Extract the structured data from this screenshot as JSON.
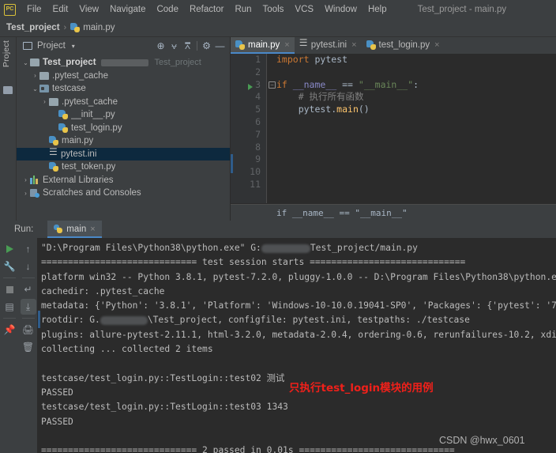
{
  "window": {
    "title": "Test_project - main.py",
    "logo_text": "PC",
    "logo_name": "pycharm-logo-icon"
  },
  "menubar": {
    "items": [
      {
        "label": "File"
      },
      {
        "label": "Edit"
      },
      {
        "label": "View"
      },
      {
        "label": "Navigate"
      },
      {
        "label": "Code"
      },
      {
        "label": "Refactor"
      },
      {
        "label": "Run"
      },
      {
        "label": "Tools"
      },
      {
        "label": "VCS"
      },
      {
        "label": "Window"
      },
      {
        "label": "Help"
      }
    ]
  },
  "breadcrumb": {
    "project": "Test_project",
    "separator": "›",
    "file": "main.py"
  },
  "tool_strip": {
    "label": "Project",
    "icon": "folder-icon"
  },
  "project_panel": {
    "title": "Project",
    "caret": "▾",
    "path_hint": "Test_project",
    "toolbar": [
      {
        "name": "locate-icon",
        "glyph": "⊕"
      },
      {
        "name": "expand-all-icon",
        "glyph": "⩝"
      },
      {
        "name": "collapse-all-icon",
        "glyph": "⩞"
      },
      {
        "name": "settings-gear-icon",
        "glyph": "⚙"
      },
      {
        "name": "hide-panel-icon",
        "glyph": "—"
      }
    ],
    "tree": [
      {
        "label": "Test_project",
        "indent": 0,
        "arrow": "⌄",
        "icon": "folder-icon",
        "bold": true,
        "selected": false,
        "hint": "Test_project",
        "blur": 60
      },
      {
        "label": ".pytest_cache",
        "indent": 1,
        "arrow": "›",
        "icon": "folder-icon",
        "bold": false,
        "selected": false
      },
      {
        "label": "testcase",
        "indent": 1,
        "arrow": "⌄",
        "icon": "source-folder-icon",
        "bold": false,
        "selected": false
      },
      {
        "label": ".pytest_cache",
        "indent": 2,
        "arrow": "›",
        "icon": "folder-icon",
        "bold": false,
        "selected": false
      },
      {
        "label": "__init__.py",
        "indent": 3,
        "arrow": "",
        "icon": "python-file-icon",
        "bold": false,
        "selected": false
      },
      {
        "label": "test_login.py",
        "indent": 3,
        "arrow": "",
        "icon": "python-file-icon",
        "bold": false,
        "selected": false
      },
      {
        "label": "main.py",
        "indent": 2,
        "arrow": "",
        "icon": "python-file-icon",
        "bold": false,
        "selected": false
      },
      {
        "label": "pytest.ini",
        "indent": 2,
        "arrow": "",
        "icon": "ini-file-icon",
        "bold": false,
        "selected": true
      },
      {
        "label": "test_token.py",
        "indent": 2,
        "arrow": "",
        "icon": "python-file-icon",
        "bold": false,
        "selected": false
      },
      {
        "label": "External Libraries",
        "indent": 0,
        "arrow": "›",
        "icon": "library-icon",
        "bold": false,
        "selected": false
      },
      {
        "label": "Scratches and Consoles",
        "indent": 0,
        "arrow": "›",
        "icon": "scratches-icon",
        "bold": false,
        "selected": false
      }
    ]
  },
  "editor": {
    "tabs": [
      {
        "label": "main.py",
        "icon": "python-file-icon",
        "active": true,
        "close": "×"
      },
      {
        "label": "pytest.ini",
        "icon": "ini-file-icon",
        "active": false,
        "close": "×"
      },
      {
        "label": "test_login.py",
        "icon": "python-file-icon",
        "active": false,
        "close": "×"
      }
    ],
    "line_numbers": [
      "1",
      "2",
      "3",
      "4",
      "5",
      "6",
      "7",
      "8",
      "9",
      "10",
      "11"
    ],
    "code": [
      {
        "num": 1,
        "segments": [
          {
            "t": "import",
            "c": "k-kw"
          },
          {
            "t": " pytest",
            "c": "k-def"
          }
        ]
      },
      {
        "num": 2,
        "segments": []
      },
      {
        "num": 3,
        "segments": [
          {
            "t": "if",
            "c": "k-kw"
          },
          {
            "t": " __name__ ",
            "c": "k-bi"
          },
          {
            "t": "== ",
            "c": "k-def"
          },
          {
            "t": "\"__main__\"",
            "c": "k-str"
          },
          {
            "t": ":",
            "c": "k-def"
          }
        ],
        "run_marker": true,
        "fold": true
      },
      {
        "num": 4,
        "segments": [
          {
            "t": "    # 执行所有函数",
            "c": "k-cm"
          }
        ]
      },
      {
        "num": 5,
        "segments": [
          {
            "t": "    pytest.",
            "c": "k-def"
          },
          {
            "t": "main",
            "c": "k-fn"
          },
          {
            "t": "()",
            "c": "k-def"
          }
        ]
      },
      {
        "num": 6,
        "segments": []
      },
      {
        "num": 7,
        "segments": []
      },
      {
        "num": 8,
        "segments": []
      },
      {
        "num": 9,
        "segments": []
      },
      {
        "num": 10,
        "segments": []
      },
      {
        "num": 11,
        "segments": []
      }
    ],
    "sticky_breadcrumb": "if __name__ == \"__main__\""
  },
  "run_panel": {
    "label": "Run:",
    "tab_label": "main",
    "tab_icon": "python-logo-icon",
    "tab_close": "×",
    "toolbar_left": [
      {
        "name": "rerun-button",
        "glyph": "▶"
      },
      {
        "name": "edit-configurations-button",
        "glyph": "🔧"
      },
      {
        "name": "stop-button",
        "glyph": "■"
      },
      {
        "name": "layout-button",
        "glyph": "▤"
      },
      {
        "name": "pin-tab-button",
        "glyph": "📌"
      }
    ],
    "toolbar_right": [
      {
        "name": "up-arrow-button",
        "glyph": "↑"
      },
      {
        "name": "down-arrow-button",
        "glyph": "↓"
      },
      {
        "name": "soft-wrap-button",
        "glyph": "↵"
      },
      {
        "name": "scroll-to-end-button",
        "glyph": "⤓",
        "active": true
      },
      {
        "name": "print-button",
        "glyph": "🖨"
      },
      {
        "name": "clear-all-button",
        "glyph": "🗑"
      }
    ],
    "console_lines": [
      {
        "pre": "\"D:\\Program Files\\Python38\\python.exe\" G:",
        "blur": 62,
        "post": "Test_project/main.py"
      },
      {
        "pre": "============================= test session starts ============================="
      },
      {
        "pre": "platform win32 -- Python 3.8.1, pytest-7.2.0, pluggy-1.0.0 -- D:\\Program Files\\Python38\\python.e"
      },
      {
        "pre": "cachedir: .pytest_cache"
      },
      {
        "pre": "metadata: {'Python': '3.8.1', 'Platform': 'Windows-10-10.0.19041-SP0', 'Packages': {'pytest': '7"
      },
      {
        "pre": "rootdir: G.",
        "blur": 60,
        "post": "\\Test_project, configfile: pytest.ini, testpaths: ./testcase"
      },
      {
        "pre": "plugins: allure-pytest-2.11.1, html-3.2.0, metadata-2.0.4, ordering-0.6, rerunfailures-10.2, xdi"
      },
      {
        "pre": "collecting ... collected 2 items"
      },
      {
        "pre": ""
      },
      {
        "pre": "testcase/test_login.py::TestLogin::test02 测试"
      },
      {
        "pre": "PASSED"
      },
      {
        "pre": "testcase/test_login.py::TestLogin::test03 1343"
      },
      {
        "pre": "PASSED"
      },
      {
        "pre": ""
      },
      {
        "pre": "============================= 2 passed in 0.01s ============================="
      }
    ],
    "annotation": "只执行test_login模块的用例",
    "watermark": "CSDN @hwx_0601"
  },
  "colors": {
    "chrome": "#3c3f41",
    "editor_bg": "#2b2b2b",
    "accent_blue": "#4a88c7",
    "selection": "#0d293e",
    "annotation_red": "#f0201a",
    "keyword_orange": "#cc7832",
    "string_green": "#6a8759",
    "run_green": "#499c54",
    "text": "#bbbbbb"
  }
}
